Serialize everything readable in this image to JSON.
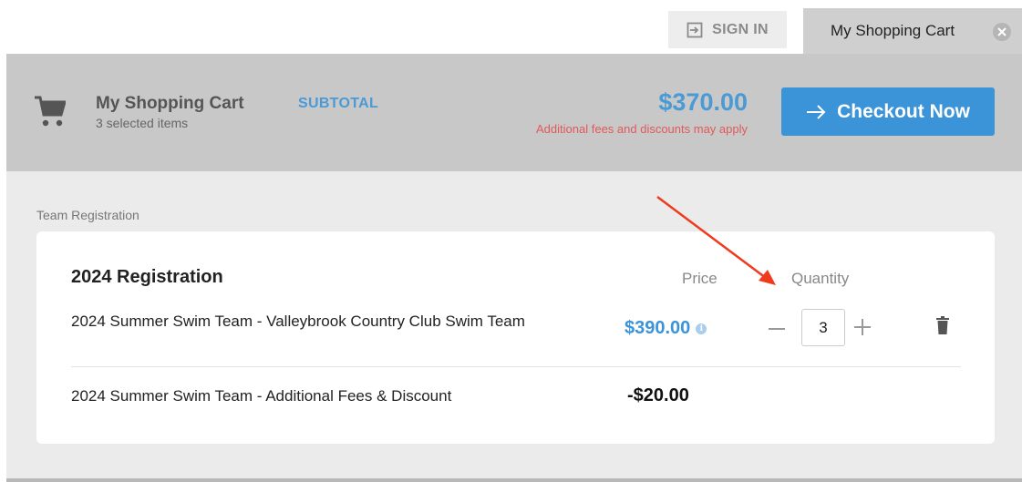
{
  "topbar": {
    "signin_label": "SIGN IN",
    "cart_tab_label": "My Shopping Cart"
  },
  "header": {
    "title": "My Shopping Cart",
    "subtitle": "3 selected items",
    "subtotal_label": "SUBTOTAL",
    "subtotal_amount": "$370.00",
    "fees_note": "Additional fees and discounts may apply",
    "checkout_label": "Checkout Now"
  },
  "section": {
    "label": "Team Registration",
    "card_title": "2024 Registration",
    "columns": {
      "price": "Price",
      "quantity": "Quantity"
    },
    "items": [
      {
        "name": "2024 Summer Swim Team - Valleybrook Country Club Swim Team",
        "price": "$390.00",
        "quantity": "3"
      },
      {
        "name": "2024 Summer Swim Team - Additional Fees & Discount",
        "price": "-$20.00"
      }
    ]
  },
  "icons": {
    "signin": "sign-in-icon",
    "close": "close-icon",
    "cart": "shopping-cart-icon",
    "checkout": "arrow-right-icon",
    "info": "info-icon",
    "minus": "minus-icon",
    "plus": "plus-icon",
    "trash": "trash-icon"
  },
  "colors": {
    "accent": "#3b93d8",
    "warning": "#e05a5a",
    "annotation": "#f03a1e"
  }
}
